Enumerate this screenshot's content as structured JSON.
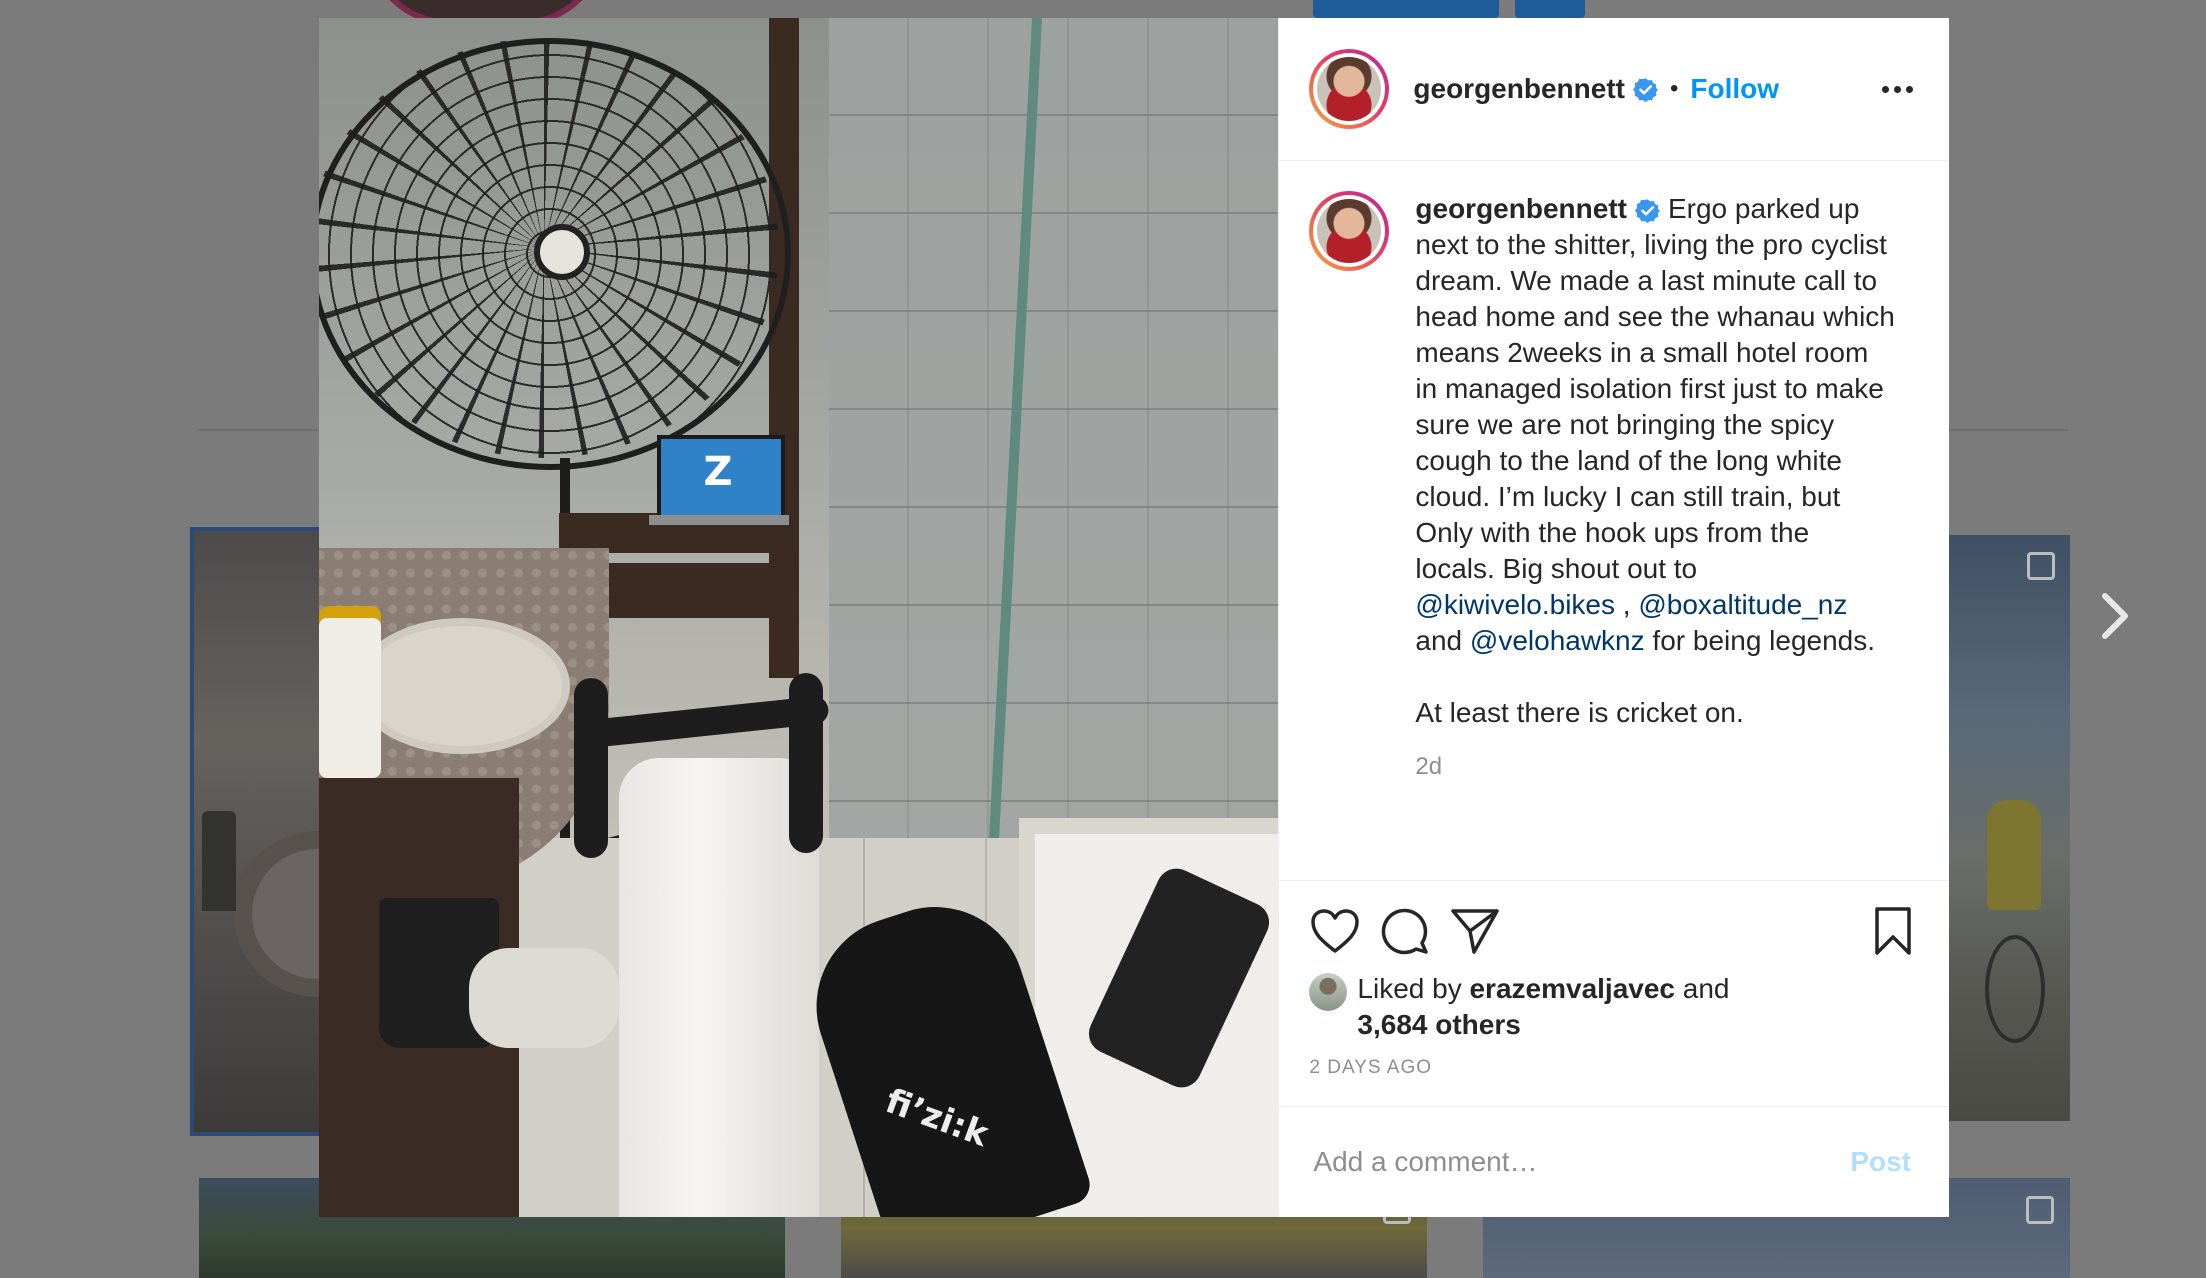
{
  "post": {
    "username": "georgenbennett",
    "follow_label": "Follow",
    "dot": "•",
    "caption": {
      "text_part1": "Ergo parked up next to the shitter, living the pro cyclist dream. We made a last minute call to head home and see the whanau which means 2weeks in a small hotel room in managed isolation first just to make sure we are not bringing the spicy cough to the land of the long white cloud. I’m lucky I can still train, but Only with the hook ups from the locals. Big shout out to ",
      "mention1": "@kiwivelo.bikes",
      "sep1": " , ",
      "mention2": "@boxaltitude_nz",
      "and_word": " and ",
      "mention3": "@velohawknz",
      "text_part2": " for being legends.\n\nAt least there is cricket on."
    },
    "age": "2d",
    "likes": {
      "prefix": "Liked by ",
      "liker": "erazemvaljavec",
      "middle": " and",
      "others": "3,684 others"
    },
    "timestamp": "2 DAYS AGO",
    "comment": {
      "placeholder": "Add a comment…",
      "post_label": "Post"
    },
    "photo": {
      "saddle_text": "fi’zi:k",
      "laptop_logo": "Z"
    }
  },
  "colors": {
    "accent": "#0095f6",
    "mention": "#00376b",
    "verified": "#3897f0",
    "muted": "#8e8e8e",
    "post_disabled": "#b2dffc"
  },
  "icons": [
    "more-icon",
    "heart-icon",
    "comment-icon",
    "share-icon",
    "bookmark-icon",
    "verified-icon",
    "chevron-right-icon"
  ]
}
